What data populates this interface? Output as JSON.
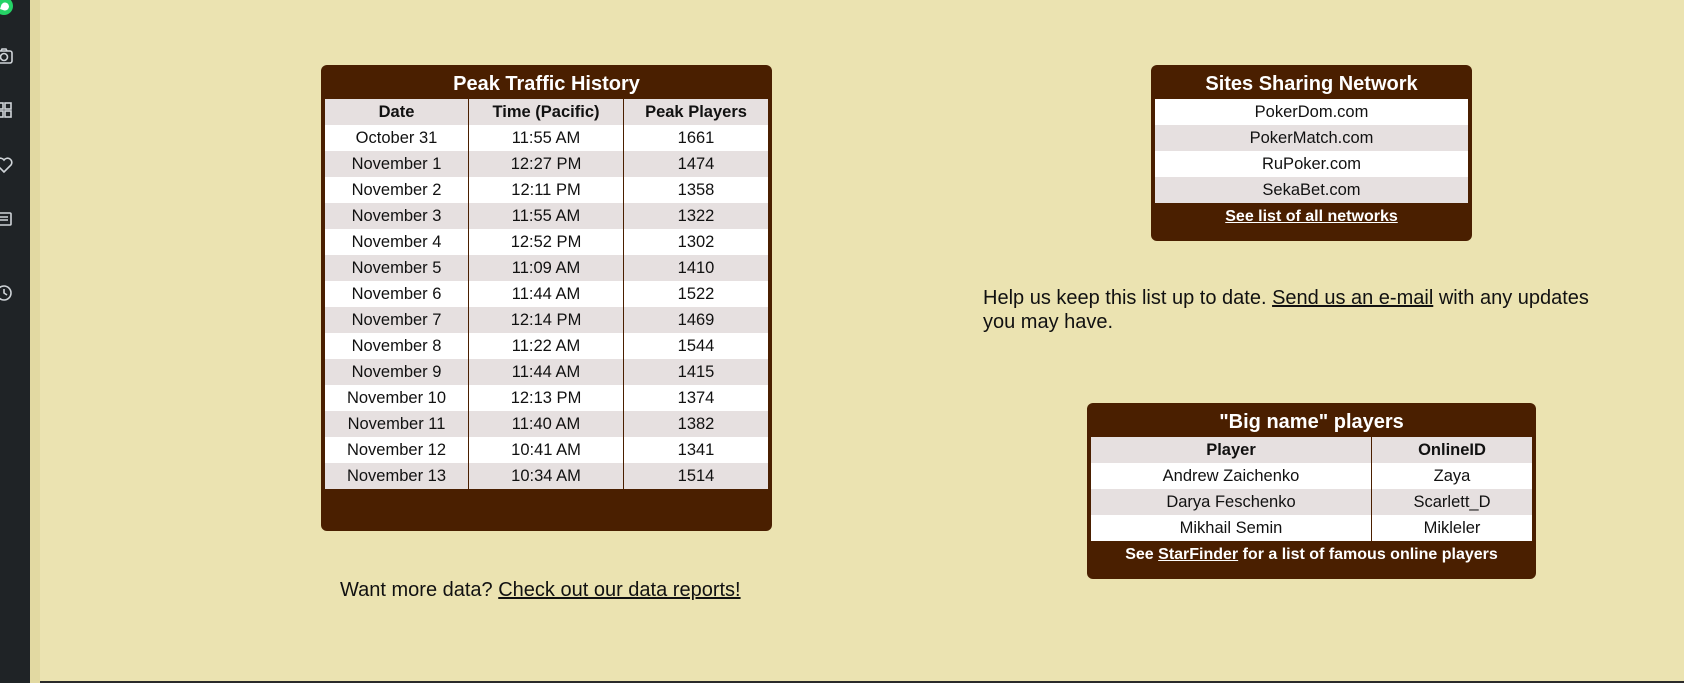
{
  "traffic": {
    "title": "Peak Traffic History",
    "headers": [
      "Date",
      "Time (Pacific)",
      "Peak Players"
    ],
    "rows": [
      [
        "October 31",
        "11:55 AM",
        "1661"
      ],
      [
        "November 1",
        "12:27 PM",
        "1474"
      ],
      [
        "November 2",
        "12:11 PM",
        "1358"
      ],
      [
        "November 3",
        "11:55 AM",
        "1322"
      ],
      [
        "November 4",
        "12:52 PM",
        "1302"
      ],
      [
        "November 5",
        "11:09 AM",
        "1410"
      ],
      [
        "November 6",
        "11:44 AM",
        "1522"
      ],
      [
        "November 7",
        "12:14 PM",
        "1469"
      ],
      [
        "November 8",
        "11:22 AM",
        "1544"
      ],
      [
        "November 9",
        "11:44 AM",
        "1415"
      ],
      [
        "November 10",
        "12:13 PM",
        "1374"
      ],
      [
        "November 11",
        "11:40 AM",
        "1382"
      ],
      [
        "November 12",
        "10:41 AM",
        "1341"
      ],
      [
        "November 13",
        "10:34 AM",
        "1514"
      ]
    ]
  },
  "more_data": {
    "prefix": "Want more data? ",
    "link": "Check out our data reports!"
  },
  "network": {
    "title": "Sites Sharing Network",
    "sites": [
      "PokerDom.com",
      "PokerMatch.com",
      "RuPoker.com",
      "SekaBet.com"
    ],
    "footer_link": "See list of all networks"
  },
  "help": {
    "prefix": "Help us keep this list up to date. ",
    "link": "Send us an e-mail",
    "suffix": " with any updates you may have."
  },
  "bignames": {
    "title": "\"Big name\" players",
    "headers": [
      "Player",
      "OnlineID"
    ],
    "rows": [
      [
        "Andrew Zaichenko",
        "Zaya"
      ],
      [
        "Darya Feschenko",
        "Scarlett_D"
      ],
      [
        "Mikhail Semin",
        "Mikleler"
      ]
    ],
    "footer_prefix": "See ",
    "footer_link": "StarFinder",
    "footer_suffix": " for a list of famous online players"
  },
  "sidebar": {
    "icons": [
      "whatsapp-icon",
      "camera-icon",
      "apps-grid-icon",
      "heart-icon",
      "news-icon",
      "history-clock-icon"
    ]
  },
  "colors": {
    "background": "#ebe3b1",
    "panel": "#4a1f00",
    "row_alt": "#e6e0e0",
    "rail": "#1f2326"
  }
}
